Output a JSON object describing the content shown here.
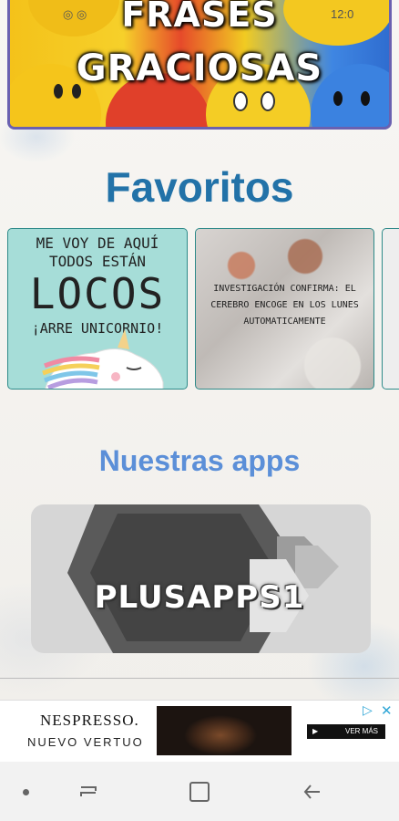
{
  "header": {
    "title_line1": "FRASES",
    "title_line2": "GRACIOSAS",
    "status_time": "12:0"
  },
  "favorites": {
    "title": "Favoritos",
    "cards": [
      {
        "lines": [
          "ME VOY DE AQUÍ",
          "TODOS ESTÁN",
          "LOCOS",
          "¡ARRE UNICORNIO!"
        ]
      },
      {
        "lines": [
          "INVESTIGACIÓN CONFIRMA: EL",
          "CEREBRO ENCOGE EN LOS LUNES",
          "AUTOMATICAMENTE"
        ]
      }
    ]
  },
  "apps": {
    "title": "Nuestras apps",
    "app_name": "PLUSAPPS1"
  },
  "ad": {
    "brand": "NESPRESSO.",
    "tagline": "NUEVO VERTUO",
    "cta": "VER MÁS"
  },
  "colors": {
    "favorites_title": "#2272a8",
    "apps_title": "#5b8fd8",
    "banner_border": "#6a61b0",
    "card_border": "#2e8a89"
  }
}
